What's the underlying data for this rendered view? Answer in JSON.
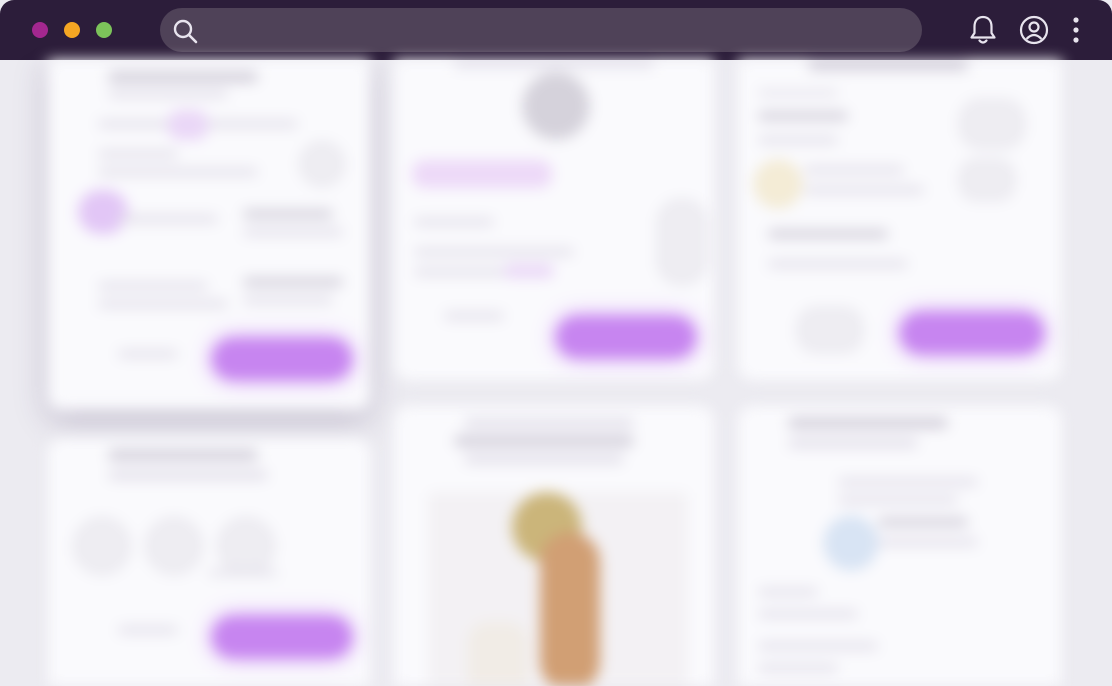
{
  "window": {
    "traffic_lights": [
      {
        "name": "close",
        "color": "#a3278f"
      },
      {
        "name": "minimize",
        "color": "#f5a623"
      },
      {
        "name": "zoom",
        "color": "#7cc35a"
      }
    ]
  },
  "toolbar": {
    "search": {
      "placeholder": "",
      "value": "",
      "icon": "search-icon"
    },
    "icons": [
      "bell-icon",
      "user-circle-icon",
      "more-vertical-icon"
    ]
  },
  "colors": {
    "titlebar": "#2c1d3a",
    "search_bg": "#4f4258",
    "icon": "#e8e4ee",
    "accent_purple": "#c785f0",
    "background": "#ecebf1",
    "card": "#fafafd"
  },
  "content": {
    "blurred": true,
    "description_visible_text": "",
    "cards": [
      {
        "name": "card-top-left"
      },
      {
        "name": "card-top-middle"
      },
      {
        "name": "card-top-right"
      },
      {
        "name": "card-bottom-left"
      },
      {
        "name": "card-bottom-middle"
      },
      {
        "name": "card-bottom-right"
      }
    ]
  }
}
